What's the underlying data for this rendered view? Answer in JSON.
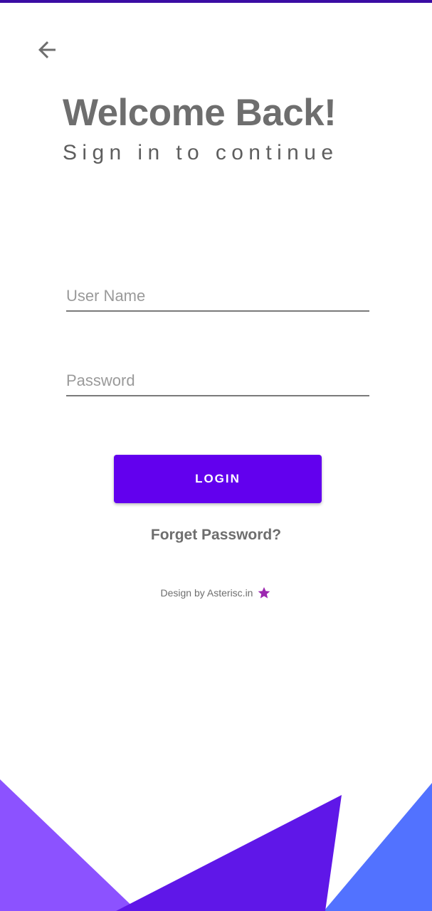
{
  "header": {
    "back_icon": "arrow-left-icon"
  },
  "welcome": {
    "title": "Welcome Back!",
    "subtitle": "Sign in to continue"
  },
  "form": {
    "username": {
      "placeholder": "User Name",
      "value": ""
    },
    "password": {
      "placeholder": "Password",
      "value": ""
    },
    "login_label": "LOGIN",
    "forget_label": "Forget Password?"
  },
  "footer": {
    "credit": "Design by Asterisc.in",
    "icon": "star-icon"
  },
  "colors": {
    "accent": "#6200ee",
    "status_bar": "#3a0ca3",
    "star": "#9c27b0",
    "decor_left": "#8c52ff",
    "decor_middle": "#5f17e8",
    "decor_right": "#5272ff"
  }
}
